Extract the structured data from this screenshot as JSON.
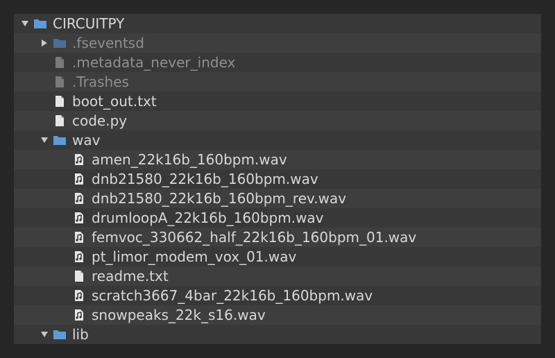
{
  "tree": {
    "root": {
      "label": "CIRCUITPY",
      "expanded": true,
      "icon": "folder-icon"
    },
    "items": [
      {
        "label": ".fseventsd",
        "type": "folder",
        "icon": "folder-icon",
        "expanded": false,
        "dim": true
      },
      {
        "label": ".metadata_never_index",
        "type": "file",
        "icon": "file-icon",
        "dim": true
      },
      {
        "label": ".Trashes",
        "type": "file",
        "icon": "file-icon",
        "dim": true
      },
      {
        "label": "boot_out.txt",
        "type": "file",
        "icon": "file-icon",
        "dim": false
      },
      {
        "label": "code.py",
        "type": "file",
        "icon": "file-icon",
        "dim": false
      },
      {
        "label": "wav",
        "type": "folder",
        "icon": "folder-icon",
        "expanded": true,
        "dim": false
      },
      {
        "label": "amen_22k16b_160bpm.wav",
        "type": "audio",
        "icon": "audio-file-icon",
        "dim": false
      },
      {
        "label": "dnb21580_22k16b_160bpm.wav",
        "type": "audio",
        "icon": "audio-file-icon",
        "dim": false
      },
      {
        "label": "dnb21580_22k16b_160bpm_rev.wav",
        "type": "audio",
        "icon": "audio-file-icon",
        "dim": false
      },
      {
        "label": "drumloopA_22k16b_160bpm.wav",
        "type": "audio",
        "icon": "audio-file-icon",
        "dim": false
      },
      {
        "label": "femvoc_330662_half_22k16b_160bpm_01.wav",
        "type": "audio",
        "icon": "audio-file-icon",
        "dim": false
      },
      {
        "label": "pt_limor_modem_vox_01.wav",
        "type": "audio",
        "icon": "audio-file-icon",
        "dim": false
      },
      {
        "label": "readme.txt",
        "type": "file",
        "icon": "file-icon",
        "dim": false
      },
      {
        "label": "scratch3667_4bar_22k16b_160bpm.wav",
        "type": "audio",
        "icon": "audio-file-icon",
        "dim": false
      },
      {
        "label": "snowpeaks_22k_s16.wav",
        "type": "audio",
        "icon": "audio-file-icon",
        "dim": false
      },
      {
        "label": "lib",
        "type": "folder",
        "icon": "folder-icon",
        "expanded": true,
        "dim": false
      }
    ]
  },
  "colors": {
    "background": "#262626",
    "panel": "#383838",
    "row_alt": "#3e3e3e",
    "text": "#d8d8d8",
    "text_dim": "#8f8f8f",
    "folder_blue": "#5c9ad8",
    "folder_dim": "#4a6f96",
    "file_icon": "#e6e6e6",
    "file_icon_dim": "#7a7a7a"
  }
}
